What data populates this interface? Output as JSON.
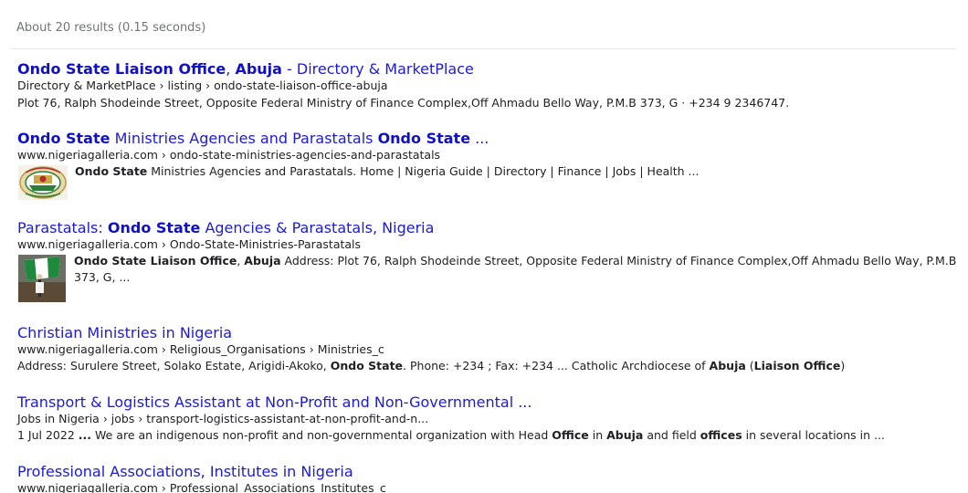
{
  "stats": "About 20 results (0.15 seconds)",
  "results": [
    {
      "title_parts": [
        {
          "t": "Ondo State Liaison Office",
          "b": true
        },
        {
          "t": ", ",
          "b": false
        },
        {
          "t": "Abuja",
          "b": true
        },
        {
          "t": " - Directory & MarketPlace",
          "b": false
        }
      ],
      "url": "Directory & MarketPlace › listing › ondo-state-liaison-office-abuja",
      "snippet_parts": [
        {
          "t": "Plot 76, Ralph Shodeinde Street, Opposite Federal Ministry of Finance Complex,Off Ahmadu Bello Way, P.M.B 373, G · +234 9 2346747.",
          "b": false
        }
      ]
    },
    {
      "title_parts": [
        {
          "t": "Ondo State",
          "b": true
        },
        {
          "t": " Ministries Agencies and Parastatals ",
          "b": false
        },
        {
          "t": "Ondo State",
          "b": true
        },
        {
          "t": " ...",
          "b": false
        }
      ],
      "url": "www.nigeriagalleria.com › ondo-state-ministries-agencies-and-parastatals",
      "thumb": "state-seal-thumbnail",
      "snippet_parts": [
        {
          "t": "Ondo State",
          "b": true
        },
        {
          "t": " Ministries Agencies and Parastatals. Home | Nigeria Guide | Directory | Finance | Jobs | Health ...",
          "b": false
        }
      ]
    },
    {
      "title_parts": [
        {
          "t": "Parastatals: ",
          "b": false
        },
        {
          "t": "Ondo State",
          "b": true
        },
        {
          "t": " Agencies & Parastatals, Nigeria",
          "b": false
        }
      ],
      "url": "www.nigeriagalleria.com › Ondo-State-Ministries-Parastatals",
      "thumb": "nigeria-flag-thumbnail",
      "snippet_parts": [
        {
          "t": "Ondo State Liaison Office",
          "b": true
        },
        {
          "t": ", ",
          "b": false
        },
        {
          "t": "Abuja",
          "b": true
        },
        {
          "t": " Address: Plot 76, Ralph Shodeinde Street, Opposite Federal Ministry of Finance Complex,Off Ahmadu Bello Way, P.M.B 373, G, ...",
          "b": false
        }
      ]
    },
    {
      "title_parts": [
        {
          "t": "Christian Ministries in Nigeria",
          "b": false
        }
      ],
      "url": "www.nigeriagalleria.com › Religious_Organisations › Ministries_c",
      "snippet_parts": [
        {
          "t": "Address: Surulere Street, Solako Estate, Arigidi-Akoko, ",
          "b": false
        },
        {
          "t": "Ondo State",
          "b": true
        },
        {
          "t": ". Phone: +234 ; Fax: +234 ... Catholic Archdiocese of ",
          "b": false
        },
        {
          "t": "Abuja",
          "b": true
        },
        {
          "t": " (",
          "b": false
        },
        {
          "t": "Liaison Office",
          "b": true
        },
        {
          "t": ")",
          "b": false
        }
      ]
    },
    {
      "title_parts": [
        {
          "t": "Transport & Logistics Assistant at Non-Profit and Non-Governmental ...",
          "b": false
        }
      ],
      "url": "Jobs in Nigeria › jobs › transport-logistics-assistant-at-non-profit-and-n...",
      "snippet_parts": [
        {
          "t": "1 Jul 2022 ",
          "b": false
        },
        {
          "t": "...",
          "b": true
        },
        {
          "t": " We are an indigenous non-profit and non-governmental organization with Head ",
          "b": false
        },
        {
          "t": "Office",
          "b": true
        },
        {
          "t": " in ",
          "b": false
        },
        {
          "t": "Abuja",
          "b": true
        },
        {
          "t": " and field ",
          "b": false
        },
        {
          "t": "offices",
          "b": true
        },
        {
          "t": " in several locations in ...",
          "b": false
        }
      ]
    },
    {
      "title_parts": [
        {
          "t": "Professional Associations, Institutes in Nigeria",
          "b": false
        }
      ],
      "url": "www.nigeriagalleria.com › Professional_Associations_Institutes_c"
    }
  ]
}
